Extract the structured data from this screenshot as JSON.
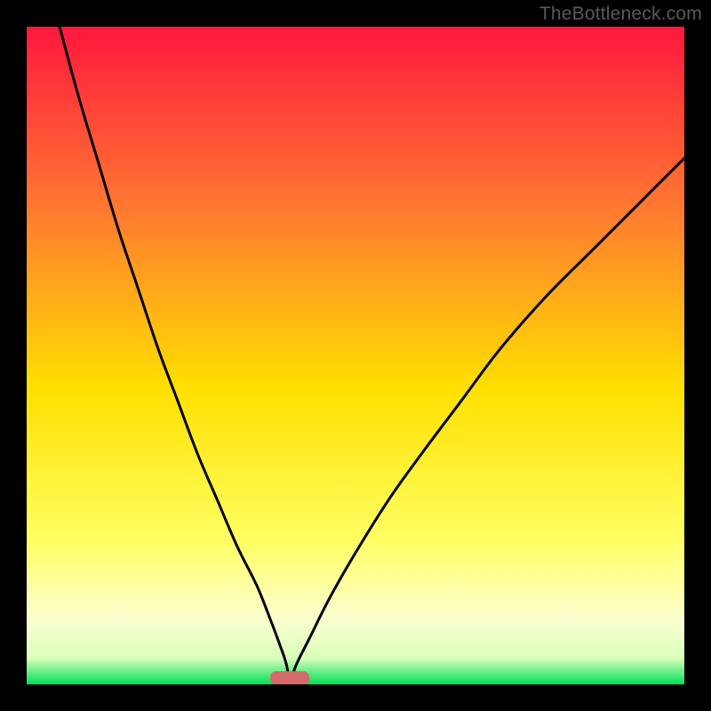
{
  "watermark": "TheBottleneck.com",
  "chart_data": {
    "type": "line",
    "title": "",
    "xlabel": "",
    "ylabel": "",
    "xlim": [
      0,
      100
    ],
    "ylim": [
      0,
      100
    ],
    "grid": false,
    "background_gradient": {
      "top": "#ff173e",
      "mid_upper": "#ff8b2e",
      "mid": "#ffe000",
      "lower_yellow": "#ffff62",
      "lower_pale": "#fbffcf",
      "bottom": "#00e05a"
    },
    "marker": {
      "shape": "rounded_bar",
      "color": "#d46a6a",
      "x_center": 40,
      "y": 0,
      "width_pct": 6,
      "height_pct": 2
    },
    "series": [
      {
        "name": "left_curve",
        "x": [
          5,
          8,
          11,
          14,
          17,
          20,
          23,
          26,
          29,
          32,
          35,
          37,
          38.5,
          39.5,
          40
        ],
        "y": [
          100,
          89,
          79,
          69,
          60,
          51,
          43,
          35,
          28,
          21,
          15,
          10,
          6,
          3,
          0
        ]
      },
      {
        "name": "right_curve",
        "x": [
          40,
          41,
          43,
          46,
          50,
          55,
          60,
          66,
          72,
          79,
          86,
          93,
          100
        ],
        "y": [
          0,
          3,
          7,
          13,
          20,
          28,
          35,
          43,
          51,
          59,
          66,
          73,
          80
        ]
      }
    ]
  }
}
